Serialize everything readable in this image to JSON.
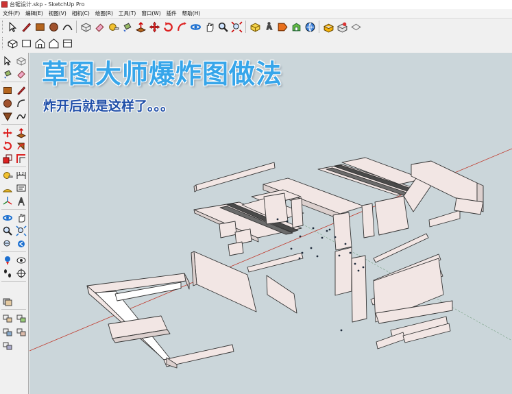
{
  "window": {
    "title": "台锯设计.skp - SketchUp Pro"
  },
  "menu": [
    "文件(F)",
    "编辑(E)",
    "视图(V)",
    "相机(C)",
    "绘图(R)",
    "工具(T)",
    "窗口(W)",
    "插件",
    "帮助(H)"
  ],
  "overlay": {
    "headline": "草图大师爆炸图做法",
    "subline": "炸开后就是这样了。。。"
  },
  "colors": {
    "viewport_bg": "#cbd6da",
    "panel_face": "#f2e6e4",
    "panel_edge": "#333333",
    "red_axis": "#c0392b",
    "green_axis": "#2e8b3a",
    "headline": "#37a6ea",
    "subline": "#1f4ea8"
  },
  "toolbar1": [
    "select-tool",
    "pencil-tool",
    "rectangle-tool",
    "circle-tool",
    "arc-tool",
    "make-component-tool",
    "eraser-tool",
    "tape-measure-tool",
    "paint-bucket-tool",
    "push-pull-tool",
    "move-tool",
    "rotate-tool",
    "follow-me-tool",
    "scale-tool",
    "offset-tool",
    "orbit-tool",
    "pan-tool",
    "zoom-tool",
    "zoom-extents-tool",
    "previous-view-tool",
    "next-view-tool",
    "position-camera-tool",
    "walk-tool",
    "look-around-tool",
    "section-plane-tool",
    "get-models-tool",
    "share-model-tool",
    "share-component-tool"
  ],
  "toolbar2": [
    "iso-view",
    "top-view",
    "front-view",
    "right-view",
    "back-view",
    "left-view"
  ],
  "lefttools": [
    "select",
    "make-component",
    "paint-bucket",
    "eraser",
    "rectangle",
    "line",
    "circle",
    "arc",
    "polygon",
    "freehand",
    "move",
    "push-pull",
    "rotate",
    "follow-me",
    "scale",
    "offset",
    "tape-measure",
    "dimension",
    "protractor",
    "text",
    "axes",
    "3d-text",
    "orbit",
    "pan",
    "zoom",
    "zoom-window",
    "zoom-extents",
    "previous",
    "position-camera",
    "look-around",
    "walk",
    "section-plane",
    "layers",
    "components",
    "styles",
    "scenes",
    "materials",
    "shadows"
  ]
}
